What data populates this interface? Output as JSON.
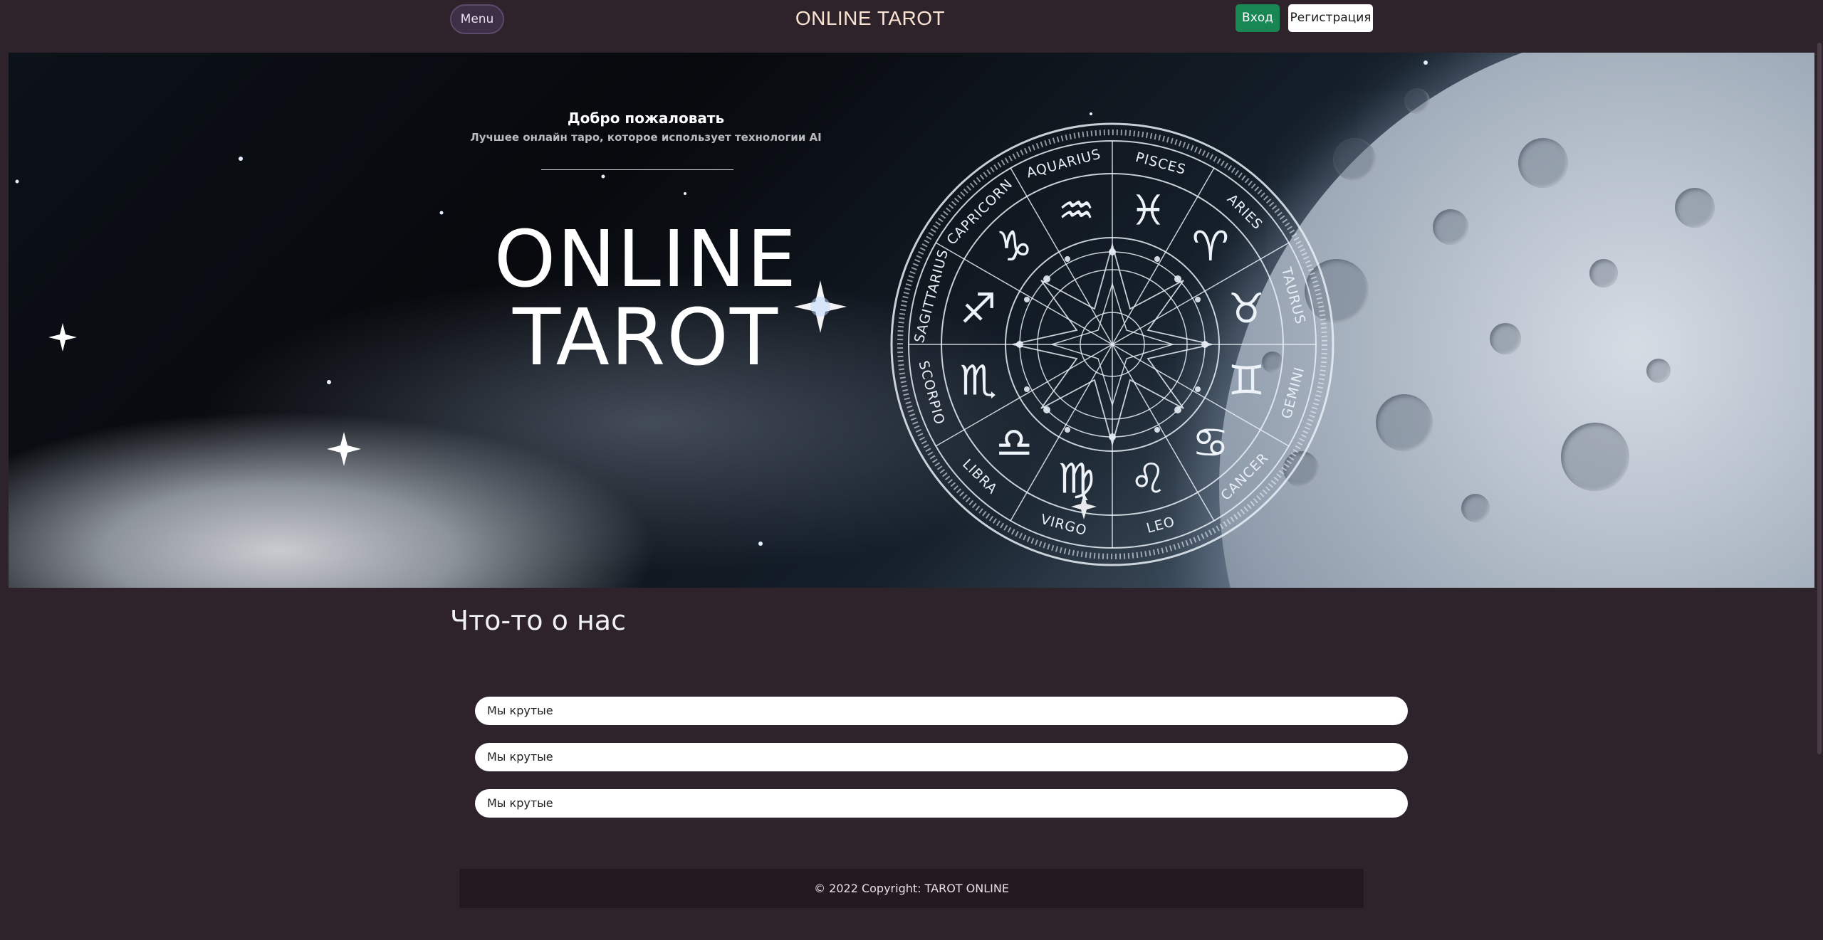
{
  "navbar": {
    "menu_label": "Menu",
    "brand": "ONLINE TAROT",
    "login_label": "Вход",
    "register_label": "Регистрация"
  },
  "hero": {
    "welcome": "Добро пожаловать",
    "subtitle": "Лучшее онлайн таро, которое использует технологии AI",
    "title_line1": "ONLINE",
    "title_line2": "TAROT",
    "zodiac_labels": [
      "PISCES",
      "ARIES",
      "TAURUS",
      "GEMINI",
      "CANCER",
      "LEO",
      "VIRGO",
      "LIBRA",
      "SCORPIO",
      "SAGITTARIUS",
      "CAPRICORN",
      "AQUARIUS"
    ],
    "zodiac_glyphs": [
      "♓",
      "♈",
      "♉",
      "♊",
      "♋",
      "♌",
      "♍",
      "♎",
      "♏",
      "♐",
      "♑",
      "♒"
    ]
  },
  "about": {
    "title": "Что-то о нас",
    "items": [
      "Мы крутые",
      "Мы крутые",
      "Мы крутые"
    ]
  },
  "footer": {
    "text": "© 2022 Copyright: TAROT ONLINE"
  },
  "colors": {
    "background": "#2e222b",
    "login_button": "#198754",
    "register_button": "#ffffff",
    "footer": "#231920",
    "brand_text": "#fbe4d2"
  }
}
